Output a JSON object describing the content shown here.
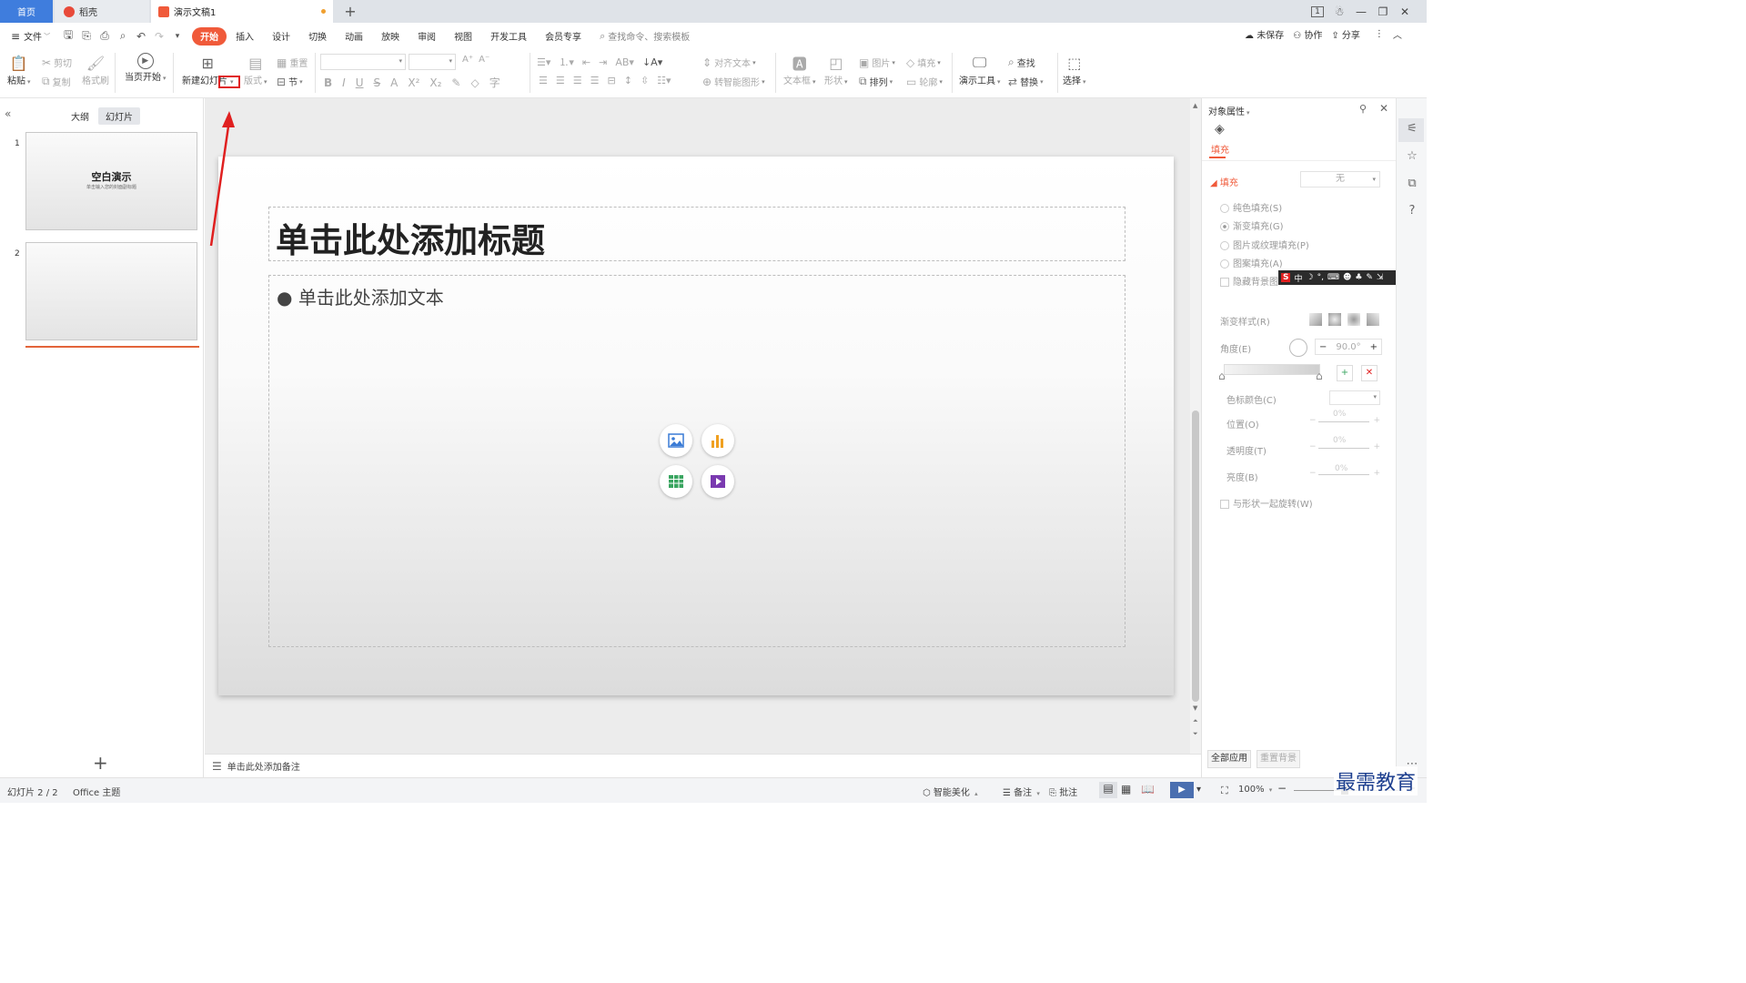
{
  "tabs": {
    "home": "首页",
    "daoke": "稻壳",
    "doc": "演示文稿1",
    "new_tab": "+"
  },
  "window_controls": {
    "restore_badge": "1"
  },
  "menubar": {
    "file": "文件",
    "items": [
      "开始",
      "插入",
      "设计",
      "切换",
      "动画",
      "放映",
      "审阅",
      "视图",
      "开发工具",
      "会员专享"
    ],
    "search_placeholder": "查找命令、搜索模板",
    "unsaved": "未保存",
    "collab": "协作",
    "share": "分享"
  },
  "ribbon": {
    "paste": "粘贴",
    "cut": "剪切",
    "copy": "复制",
    "format_painter": "格式刷",
    "from_current": "当页开始",
    "new_slide": "新建幻灯片",
    "layout": "版式",
    "reset": "重置",
    "section": "节",
    "align_text": "对齐文本",
    "smart_shape": "转智能图形",
    "textbox": "文本框",
    "shape": "形状",
    "picture": "图片",
    "fill": "填充",
    "arrange": "排列",
    "outline": "轮廓",
    "presenter_tools": "演示工具",
    "find": "查找",
    "replace": "替换",
    "select": "选择"
  },
  "left_panel": {
    "tab_outline": "大纲",
    "tab_slides": "幻灯片",
    "slides": [
      {
        "num": "1",
        "title": "空白演示",
        "subtitle": "单击输入您的封面副标题"
      },
      {
        "num": "2"
      }
    ],
    "add": "+"
  },
  "slide": {
    "title_placeholder": "单击此处添加标题",
    "body_placeholder": "单击此处添加文本"
  },
  "notes": {
    "placeholder": "单击此处添加备注"
  },
  "right_pane": {
    "title": "对象属性",
    "tab_fill": "填充",
    "section_fill": "填充",
    "fill_value": "无",
    "options": [
      "纯色填充(S)",
      "渐变填充(G)",
      "图片或纹理填充(P)",
      "图案填充(A)"
    ],
    "hide_bg": "隐藏背景图",
    "gradient_style": "渐变样式(R)",
    "angle": "角度(E)",
    "angle_value": "90.0°",
    "stop_color": "色标颜色(C)",
    "position": "位置(O)",
    "transparency": "透明度(T)",
    "brightness": "亮度(B)",
    "pct": "0%",
    "rotate_with_shape": "与形状一起旋转(W)",
    "apply_all": "全部应用",
    "reset_bg": "重置背景"
  },
  "statusbar": {
    "slide_count": "幻灯片 2 / 2",
    "theme": "Office 主题",
    "smart_beautify": "智能美化",
    "notes": "备注",
    "comments": "批注",
    "zoom": "100%"
  },
  "watermark": "最需教育",
  "colors": {
    "accent": "#f05a3a",
    "home_tab": "#3f7ddd",
    "annotation_red": "#e02020"
  }
}
